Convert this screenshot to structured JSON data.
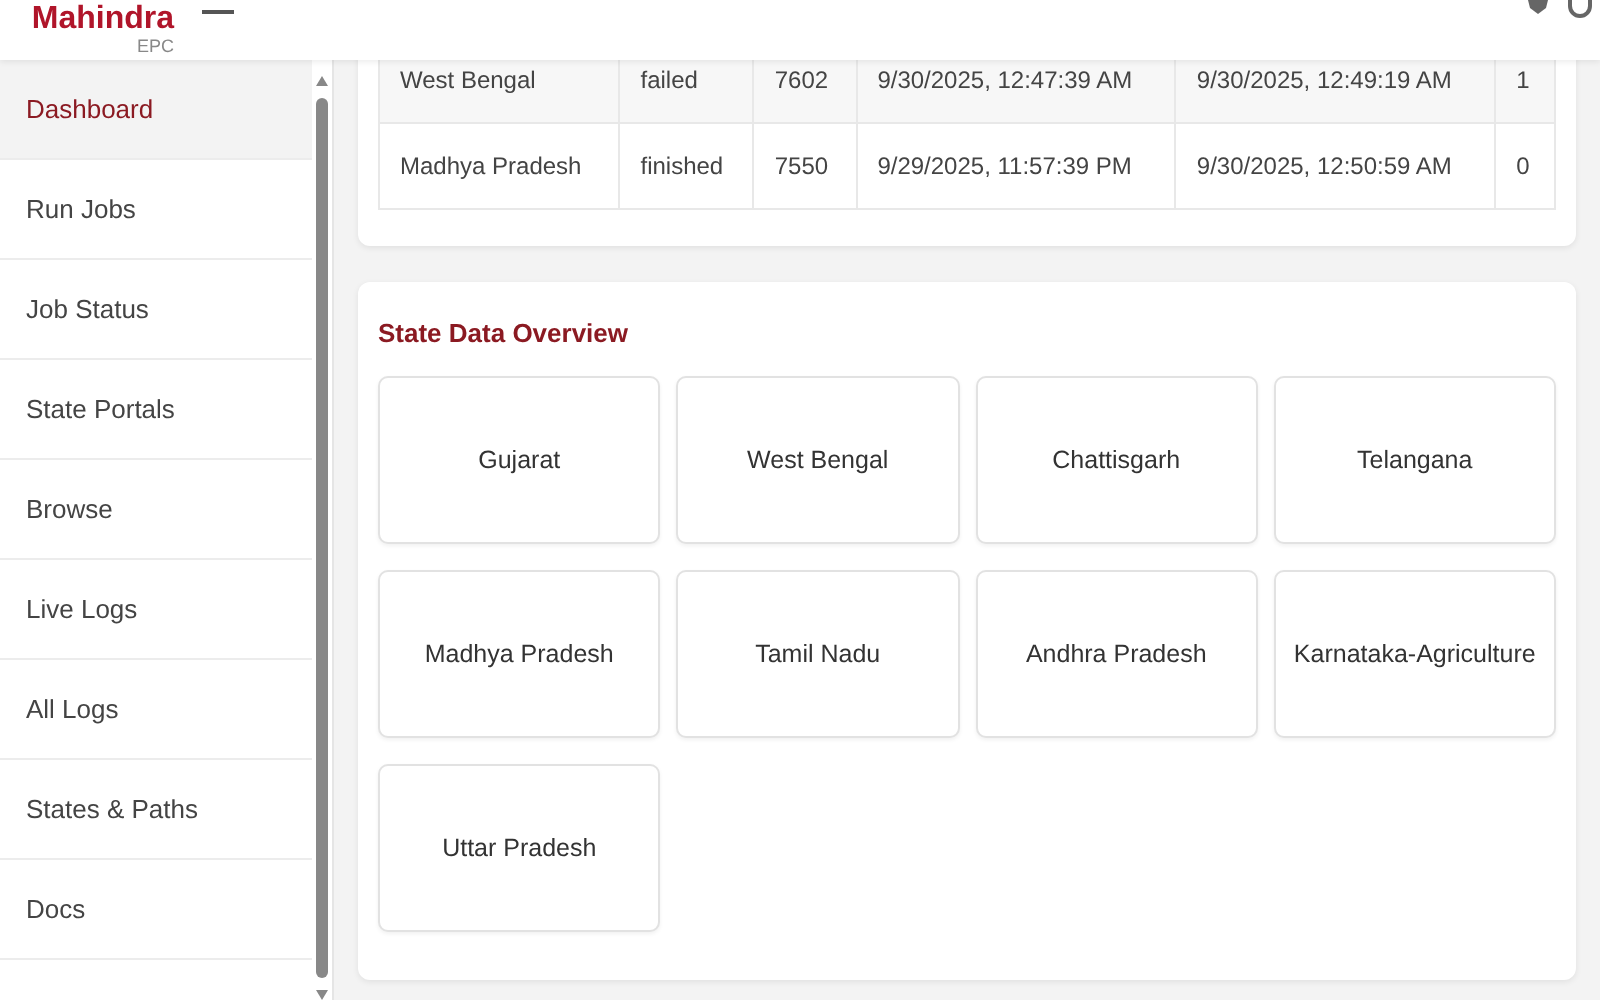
{
  "header": {
    "logo": "Mahindra",
    "logo_sub": "EPC"
  },
  "sidebar": {
    "items": [
      {
        "label": "Dashboard",
        "selected": true
      },
      {
        "label": "Run Jobs",
        "selected": false
      },
      {
        "label": "Job Status",
        "selected": false
      },
      {
        "label": "State Portals",
        "selected": false
      },
      {
        "label": "Browse",
        "selected": false
      },
      {
        "label": "Live Logs",
        "selected": false
      },
      {
        "label": "All Logs",
        "selected": false
      },
      {
        "label": "States & Paths",
        "selected": false
      },
      {
        "label": "Docs",
        "selected": false
      }
    ]
  },
  "jobs_table": {
    "rows": [
      [
        "West Bengal",
        "failed",
        "7602",
        "9/30/2025, 12:47:39 AM",
        "9/30/2025, 12:49:19 AM",
        "1"
      ],
      [
        "Madhya Pradesh",
        "finished",
        "7550",
        "9/29/2025, 11:57:39 PM",
        "9/30/2025, 12:50:59 AM",
        "0"
      ]
    ]
  },
  "state_overview": {
    "title": "State Data Overview",
    "states": [
      "Gujarat",
      "West Bengal",
      "Chattisgarh",
      "Telangana",
      "Madhya Pradesh",
      "Tamil Nadu",
      "Andhra Pradesh",
      "Karnataka-Agriculture",
      "Uttar Pradesh"
    ]
  }
}
